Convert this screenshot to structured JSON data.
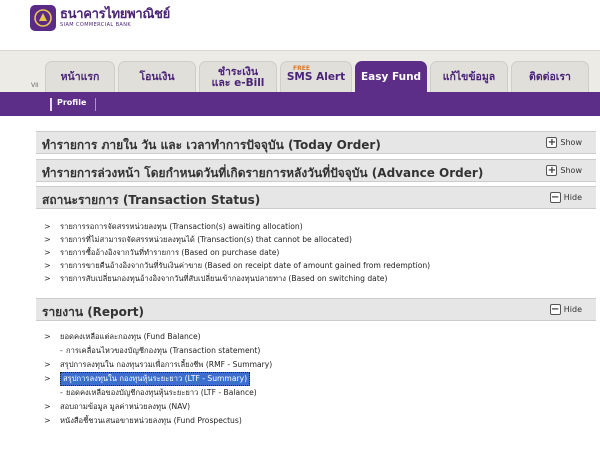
{
  "header": {
    "logo_th": "ธนาคารไทยพาณิชย์",
    "logo_en": "SIAM COMMERCIAL BANK"
  },
  "nav": {
    "version_label": "VII",
    "tabs": [
      {
        "label": "หน้าแรก"
      },
      {
        "label": "โอนเงิน"
      },
      {
        "label": "ชำระเงิน\nและ e-Bill"
      },
      {
        "label": "SMS Alert",
        "badge": "FREE"
      },
      {
        "label": "Easy Fund",
        "active": true
      },
      {
        "label": "แก้ไขข้อมูล"
      },
      {
        "label": "ติดต่อเรา"
      }
    ]
  },
  "subnav": {
    "profile_label": "Profile"
  },
  "sections": {
    "today_order": {
      "title": "ทำรายการ ภายใน วัน และ เวลาทำการปัจจุบัน (Today Order)",
      "toggle": "Show"
    },
    "advance_order": {
      "title": "ทำรายการล่วงหน้า โดยกำหนดวันที่เกิดรายการหลังวันที่ปัจจุบัน (Advance Order)",
      "toggle": "Show"
    },
    "transaction_status": {
      "title": "สถานะรายการ (Transaction Status)",
      "toggle": "Hide",
      "items": [
        "รายการรอการจัดสรรหน่วยลงทุน (Transaction(s) awaiting allocation)",
        "รายการที่ไม่สามารถจัดสรรหน่วยลงทุนได้ (Transaction(s) that cannot be allocated)",
        "รายการซื้ออ้างอิงจากวันที่ทำรายการ (Based on purchase date)",
        "รายการขายคืนอ้างอิงจากวันที่รับเงินค่าขาย (Based on receipt date of amount gained from redemption)",
        "รายการสับเปลี่ยนกองทุนอ้างอิงจากวันที่สับเปลี่ยนเข้ากองทุนปลายทาง (Based on switching date)"
      ]
    },
    "report": {
      "title": "รายงาน (Report)",
      "toggle": "Hide",
      "items": [
        {
          "text": "ยอดคงเหลือแต่ละกองทุน (Fund Balance)",
          "level": 0
        },
        {
          "text": "การเคลื่อนไหวของบัญชีกองทุน (Transaction statement)",
          "level": 1
        },
        {
          "text": "สรุปการลงทุนใน กองทุนรวมเพื่อการเลี้ยงชีพ (RMF - Summary)",
          "level": 0
        },
        {
          "text": "สรุปการลงทุนใน กองทุนหุ้นระยะยาว (LTF - Summary)",
          "level": 0,
          "highlighted": true
        },
        {
          "text": "ยอดคงเหลือของบัญชีกองทุนหุ้นระยะยาว (LTF - Balance)",
          "level": 1
        },
        {
          "text": "สอบถามข้อมูล มูลค่าหน่วยลงทุน (NAV)",
          "level": 0
        },
        {
          "text": "หนังสือชี้ชวนเสนอขายหน่วยลงทุน (Fund Prospectus)",
          "level": 0
        }
      ]
    }
  },
  "colors": {
    "brand_purple": "#5c2e88",
    "highlight": "#3b6fcf"
  }
}
